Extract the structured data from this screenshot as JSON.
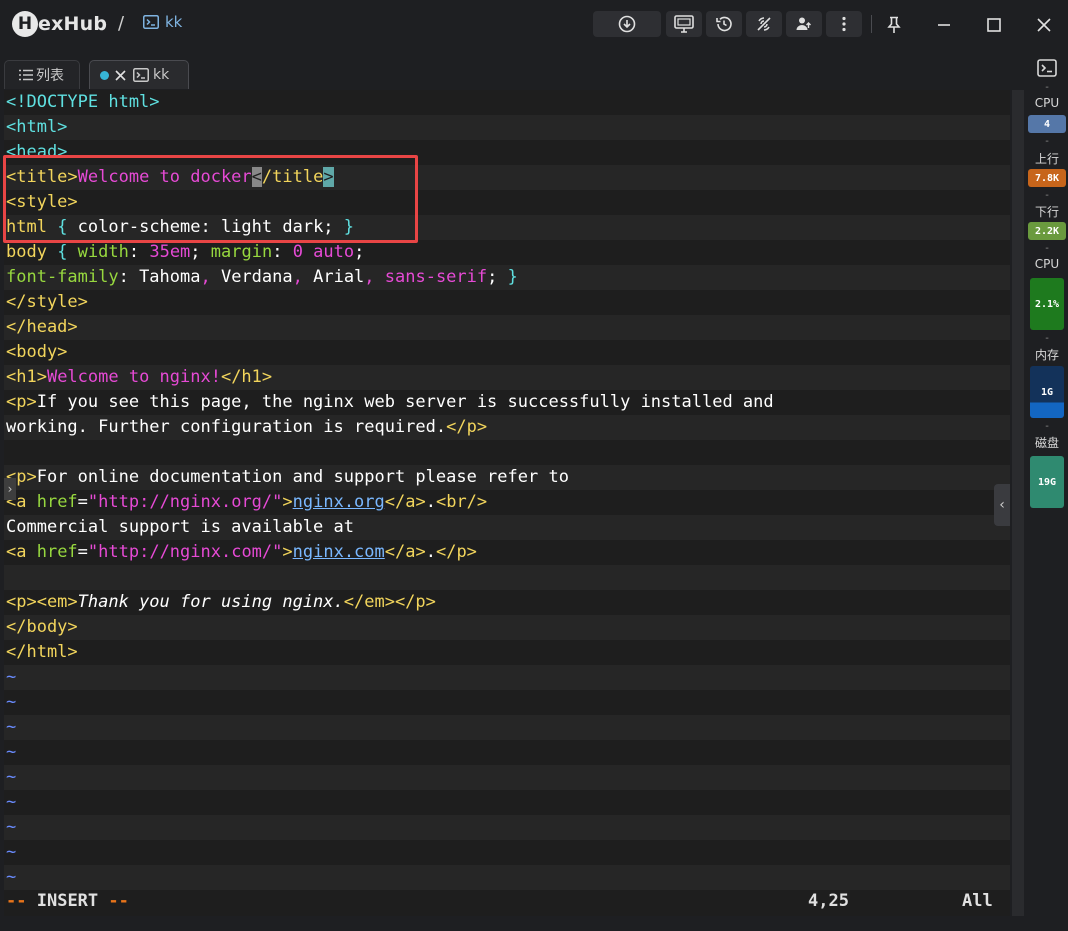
{
  "app": {
    "logo_letter": "H",
    "name": "exHub",
    "breadcrumb_sep": "/",
    "session_name": "kk"
  },
  "tabs": [
    {
      "label": "列表",
      "icon": "list-icon"
    },
    {
      "label": "kk",
      "icon": "terminal-icon",
      "status": "connected-dot"
    }
  ],
  "editor": {
    "lines": [
      [
        {
          "c": "t-br",
          "t": "<!DOCTYPE html>"
        }
      ],
      [
        {
          "c": "t-br",
          "t": "<html>"
        }
      ],
      [
        {
          "c": "t-br",
          "t": "<head>"
        }
      ],
      [
        {
          "c": "t-tag",
          "t": "<title>"
        },
        {
          "c": "t-pink",
          "t": "Welcome to docker"
        },
        {
          "c": "cursor-box",
          "t": "<"
        },
        {
          "c": "t-tag",
          "t": "/title"
        },
        {
          "c": "cursor-box2",
          "t": ">"
        }
      ],
      [
        {
          "c": "t-tag",
          "t": "<style>"
        }
      ],
      [
        {
          "c": "t-tag",
          "t": "html "
        },
        {
          "c": "t-br",
          "t": "{"
        },
        {
          "c": "t-txt",
          "t": " color-scheme: light dark; "
        },
        {
          "c": "t-br",
          "t": "}"
        }
      ],
      [
        {
          "c": "t-tag",
          "t": "body "
        },
        {
          "c": "t-br",
          "t": "{"
        },
        {
          "c": "t-attr",
          "t": " width"
        },
        {
          "c": "t-txt",
          "t": ": "
        },
        {
          "c": "t-pink",
          "t": "35em"
        },
        {
          "c": "t-txt",
          "t": "; "
        },
        {
          "c": "t-attr",
          "t": "margin"
        },
        {
          "c": "t-txt",
          "t": ": "
        },
        {
          "c": "t-pink",
          "t": "0 auto"
        },
        {
          "c": "t-txt",
          "t": ";"
        }
      ],
      [
        {
          "c": "t-attr",
          "t": "font-family"
        },
        {
          "c": "t-txt",
          "t": ": Tahoma"
        },
        {
          "c": "t-pink",
          "t": ", "
        },
        {
          "c": "t-txt",
          "t": "Verdana"
        },
        {
          "c": "t-pink",
          "t": ", "
        },
        {
          "c": "t-txt",
          "t": "Arial"
        },
        {
          "c": "t-pink",
          "t": ", sans-serif"
        },
        {
          "c": "t-txt",
          "t": "; "
        },
        {
          "c": "t-br",
          "t": "}"
        }
      ],
      [
        {
          "c": "t-tag",
          "t": "</style>"
        }
      ],
      [
        {
          "c": "t-tag",
          "t": "</head>"
        }
      ],
      [
        {
          "c": "t-tag",
          "t": "<body>"
        }
      ],
      [
        {
          "c": "t-tag",
          "t": "<h1>"
        },
        {
          "c": "t-pink",
          "t": "Welcome to nginx!"
        },
        {
          "c": "t-tag",
          "t": "</h1>"
        }
      ],
      [
        {
          "c": "t-tag",
          "t": "<p>"
        },
        {
          "c": "t-txt",
          "t": "If you see this page, the nginx web server is successfully installed and"
        }
      ],
      [
        {
          "c": "t-txt",
          "t": "working. Further configuration is required."
        },
        {
          "c": "t-tag",
          "t": "</p>"
        }
      ],
      [
        {
          "c": "t-txt",
          "t": ""
        }
      ],
      [
        {
          "c": "t-tag",
          "t": "<p>"
        },
        {
          "c": "t-txt",
          "t": "For online documentation and support please refer to"
        }
      ],
      [
        {
          "c": "t-tag",
          "t": "<a "
        },
        {
          "c": "t-attr",
          "t": "href"
        },
        {
          "c": "t-txt",
          "t": "="
        },
        {
          "c": "t-str",
          "t": "\"http://nginx.org/\""
        },
        {
          "c": "t-tag",
          "t": ">"
        },
        {
          "c": "t-link",
          "t": "nginx.org"
        },
        {
          "c": "t-tag",
          "t": "</a>"
        },
        {
          "c": "t-txt",
          "t": "."
        },
        {
          "c": "t-tag",
          "t": "<br/>"
        }
      ],
      [
        {
          "c": "t-txt",
          "t": "Commercial support is available at"
        }
      ],
      [
        {
          "c": "t-tag",
          "t": "<a "
        },
        {
          "c": "t-attr",
          "t": "href"
        },
        {
          "c": "t-txt",
          "t": "="
        },
        {
          "c": "t-str",
          "t": "\"http://nginx.com/\""
        },
        {
          "c": "t-tag",
          "t": ">"
        },
        {
          "c": "t-link",
          "t": "nginx.com"
        },
        {
          "c": "t-tag",
          "t": "</a>"
        },
        {
          "c": "t-txt",
          "t": "."
        },
        {
          "c": "t-tag",
          "t": "</p>"
        }
      ],
      [
        {
          "c": "t-txt",
          "t": ""
        }
      ],
      [
        {
          "c": "t-tag",
          "t": "<p><em>"
        },
        {
          "c": "t-em",
          "t": "Thank you for using nginx."
        },
        {
          "c": "t-tag",
          "t": "</em></p>"
        }
      ],
      [
        {
          "c": "t-tag",
          "t": "</body>"
        }
      ],
      [
        {
          "c": "t-tag",
          "t": "</html>"
        }
      ],
      [
        {
          "c": "t-tilde",
          "t": "~"
        }
      ],
      [
        {
          "c": "t-tilde",
          "t": "~"
        }
      ],
      [
        {
          "c": "t-tilde",
          "t": "~"
        }
      ],
      [
        {
          "c": "t-tilde",
          "t": "~"
        }
      ],
      [
        {
          "c": "t-tilde",
          "t": "~"
        }
      ],
      [
        {
          "c": "t-tilde",
          "t": "~"
        }
      ],
      [
        {
          "c": "t-tilde",
          "t": "~"
        }
      ],
      [
        {
          "c": "t-tilde",
          "t": "~"
        }
      ],
      [
        {
          "c": "t-tilde",
          "t": "~"
        }
      ]
    ],
    "status_dash1": "--",
    "status_mode": "INSERT",
    "status_dash2": "--",
    "cursor_pos": "4,25",
    "scroll_pos": "All"
  },
  "monitor": {
    "cpu_label": "CPU",
    "cpu_cores": "4",
    "up_label": "上行",
    "up_value": "7.8K",
    "down_label": "下行",
    "down_value": "2.2K",
    "cpu2_label": "CPU",
    "cpu_usage": "2.1%",
    "mem_label": "内存",
    "mem_value": "1G",
    "disk_label": "磁盘",
    "disk_value": "19G",
    "dash": "-",
    "colors": {
      "cores": "#5577a8",
      "up": "#c7651b",
      "down": "#6a9a3e",
      "cpu_usage": "#1e7a1e",
      "mem": "#1366c2",
      "disk": "#2f8a70"
    }
  },
  "colors": {
    "highlight_box": "#e84545",
    "background": "#1e1f22"
  }
}
